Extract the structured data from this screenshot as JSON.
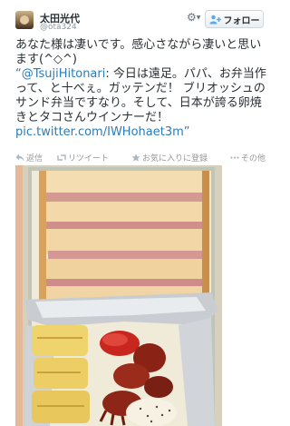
{
  "user": {
    "display_name": "太田光代",
    "handle": "@ota324"
  },
  "header": {
    "settings_icon": "gear-icon",
    "follow_label": "フォロー",
    "follow_icon": "follow-user-icon"
  },
  "tweet": {
    "line1": "あなた様は凄いです。感心さながら凄いと思います(^◇^)",
    "quote_mention": "“@TsujiHitonari",
    "quote_body": ": 今日は遠足。パパ、お弁当作って、と十べぇ。ガッテンだ！ ブリオッシュのサンド弁当ですなり。そして、日本が誇る卵焼きとタコさんウインナーだ！ ",
    "quote_link": "pic.twitter.com/IWHohaet3m",
    "quote_end": "”"
  },
  "actions": {
    "reply": {
      "label": "返信",
      "icon": "reply-icon"
    },
    "retweet": {
      "label": "リツイート",
      "icon": "retweet-icon"
    },
    "favorite": {
      "label": "お気に入りに登録",
      "icon": "star-icon"
    },
    "more": {
      "label": "その他",
      "icon": "more-dots-icon"
    }
  },
  "colors": {
    "link": "#2b7bb9",
    "text": "#292f33",
    "muted": "#999999"
  }
}
